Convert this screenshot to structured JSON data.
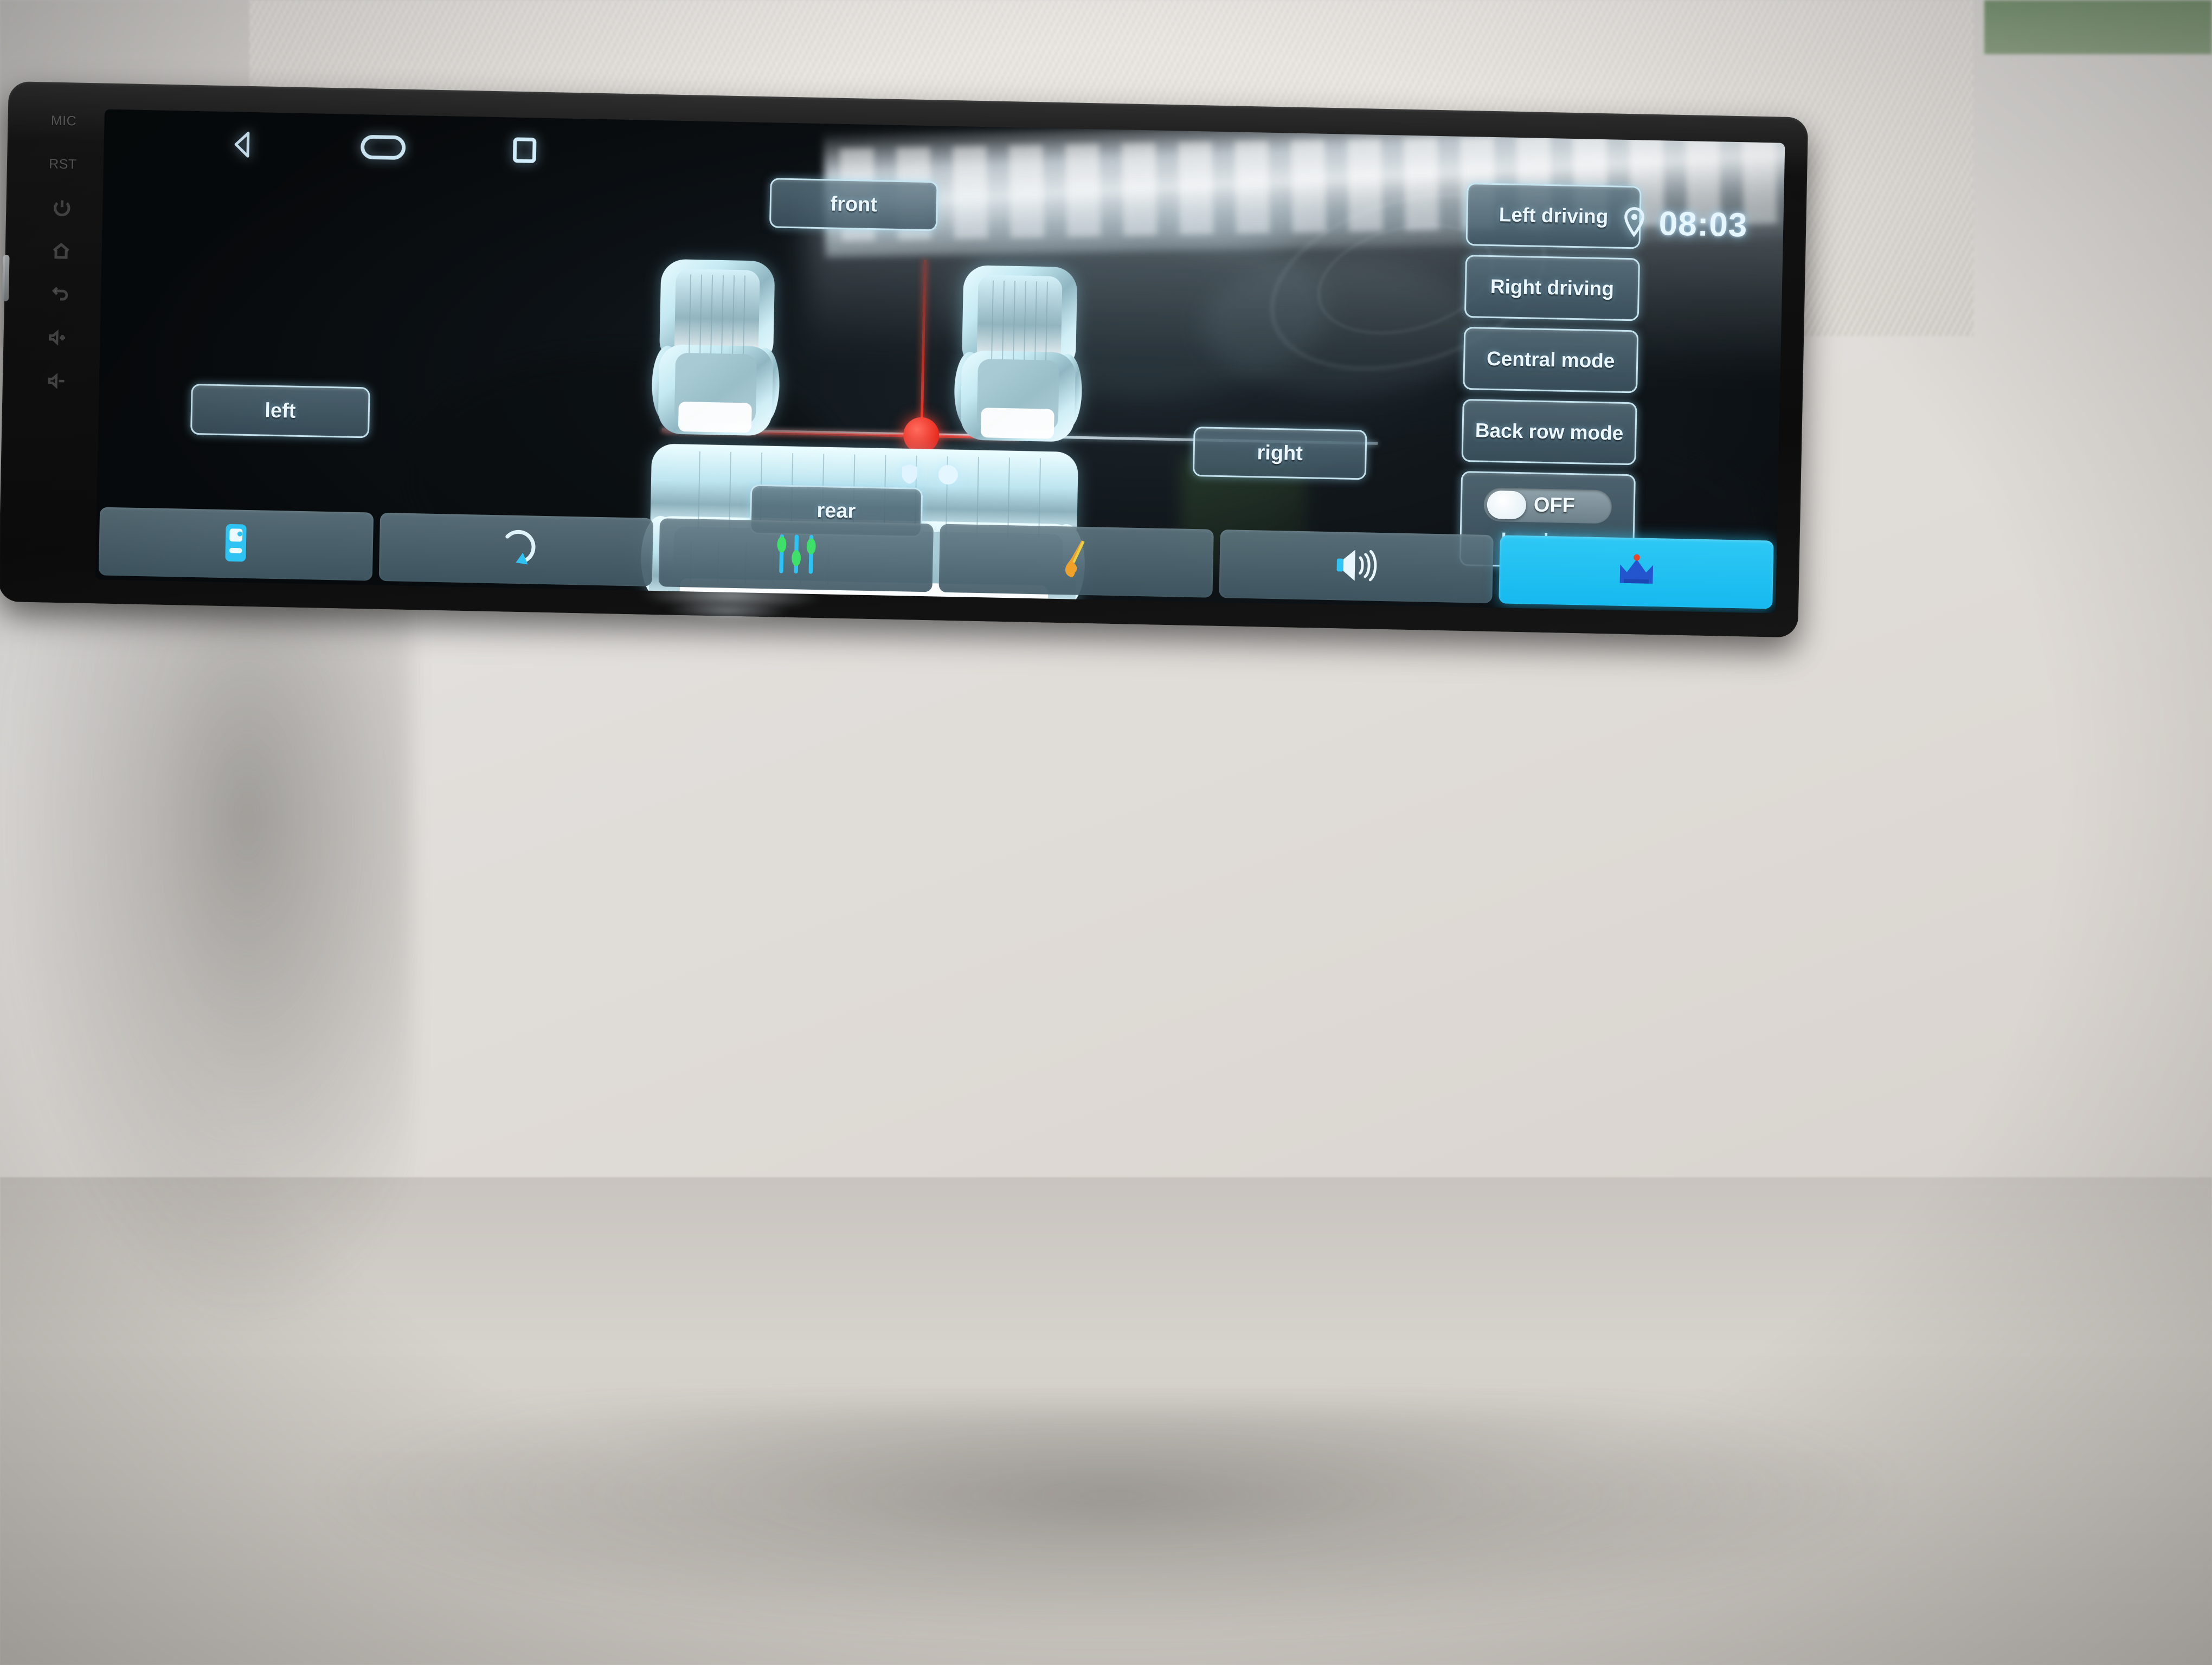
{
  "device": {
    "hardware_labels": [
      "MIC",
      "RST"
    ],
    "hardware_icons": [
      "power-icon",
      "home-icon",
      "back-icon",
      "volume-up-icon",
      "volume-down-icon"
    ]
  },
  "statusbar": {
    "nav_icons": [
      "back-icon",
      "home-icon",
      "recents-icon"
    ],
    "status_icons": [
      "shield-icon",
      "circle-icon"
    ],
    "location_icon": "location-pin-icon",
    "time": "08:03"
  },
  "sound_field": {
    "front_label": "front",
    "rear_label": "rear",
    "left_label": "left",
    "right_label": "right",
    "marker_color": "#e8281c",
    "axis_color": "#eaf7ff",
    "seats": [
      "front-left-seat",
      "front-right-seat",
      "rear-bench-seat"
    ]
  },
  "presets": {
    "items": [
      {
        "label": "Left driving",
        "name": "left-driving"
      },
      {
        "label": "Right driving",
        "name": "right-driving"
      },
      {
        "label": "Central mode",
        "name": "central-mode"
      },
      {
        "label": "Back row mode",
        "name": "back-row-mode"
      }
    ],
    "loudness": {
      "toggle_state": "OFF",
      "label": "Loudness"
    }
  },
  "toolbar": {
    "items": [
      {
        "name": "balance-fader-icon",
        "active": false
      },
      {
        "name": "reset-icon",
        "active": false
      },
      {
        "name": "equalizer-icon",
        "active": false
      },
      {
        "name": "instrument-icon",
        "active": false
      },
      {
        "name": "volume-icon",
        "active": false
      },
      {
        "name": "crown-icon",
        "active": true
      }
    ],
    "active_index": 5,
    "active_color": "#1fc4f2"
  },
  "colors": {
    "accent_cyan": "#1fc4f2",
    "button_border": "#cfeefa",
    "button_fill": "#3e5663",
    "screen_bg": "#0a0f12",
    "marker_red": "#e8281c",
    "text": "#eaf7ff"
  }
}
